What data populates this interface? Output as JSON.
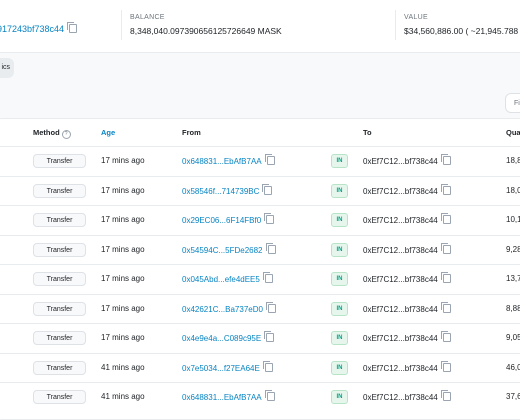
{
  "overview": {
    "address": "917243bf738c44",
    "balance_label": "BALANCE",
    "balance_value": "8,348,040.097390656125726649 MASK",
    "value_label": "VALUE",
    "value_value": "$34,560,886.00 ( ~21,945.788"
  },
  "tab_fragment": "ics",
  "filter_fragment": "Fi",
  "table": {
    "headers": {
      "method": "Method",
      "age": "Age",
      "from": "From",
      "to": "To",
      "quantity": "Qua"
    },
    "rows": [
      {
        "method": "Transfer",
        "age": "17 mins ago",
        "from": "0x648831...EbAfB7AA",
        "direction": "IN",
        "to": "0xEf7C12...bf738c44",
        "quantity": "18,8"
      },
      {
        "method": "Transfer",
        "age": "17 mins ago",
        "from": "0x58546f...714739BC",
        "direction": "IN",
        "to": "0xEf7C12...bf738c44",
        "quantity": "18,0"
      },
      {
        "method": "Transfer",
        "age": "17 mins ago",
        "from": "0x29EC06...6F14FBf0",
        "direction": "IN",
        "to": "0xEf7C12...bf738c44",
        "quantity": "10,1"
      },
      {
        "method": "Transfer",
        "age": "17 mins ago",
        "from": "0x54594C...5FDe2682",
        "direction": "IN",
        "to": "0xEf7C12...bf738c44",
        "quantity": "9,28"
      },
      {
        "method": "Transfer",
        "age": "17 mins ago",
        "from": "0x045Abd...efe4dEE5",
        "direction": "IN",
        "to": "0xEf7C12...bf738c44",
        "quantity": "13,7"
      },
      {
        "method": "Transfer",
        "age": "17 mins ago",
        "from": "0x42621C...Ba737eD0",
        "direction": "IN",
        "to": "0xEf7C12...bf738c44",
        "quantity": "8,88"
      },
      {
        "method": "Transfer",
        "age": "17 mins ago",
        "from": "0x4e9e4a...C089c95E",
        "direction": "IN",
        "to": "0xEf7C12...bf738c44",
        "quantity": "9,05"
      },
      {
        "method": "Transfer",
        "age": "41 mins ago",
        "from": "0x7e5034...f27EA64E",
        "direction": "IN",
        "to": "0xEf7C12...bf738c44",
        "quantity": "46,0"
      },
      {
        "method": "Transfer",
        "age": "41 mins ago",
        "from": "0x648831...EbAfB7AA",
        "direction": "IN",
        "to": "0xEf7C12...bf738c44",
        "quantity": "37,6"
      }
    ]
  }
}
